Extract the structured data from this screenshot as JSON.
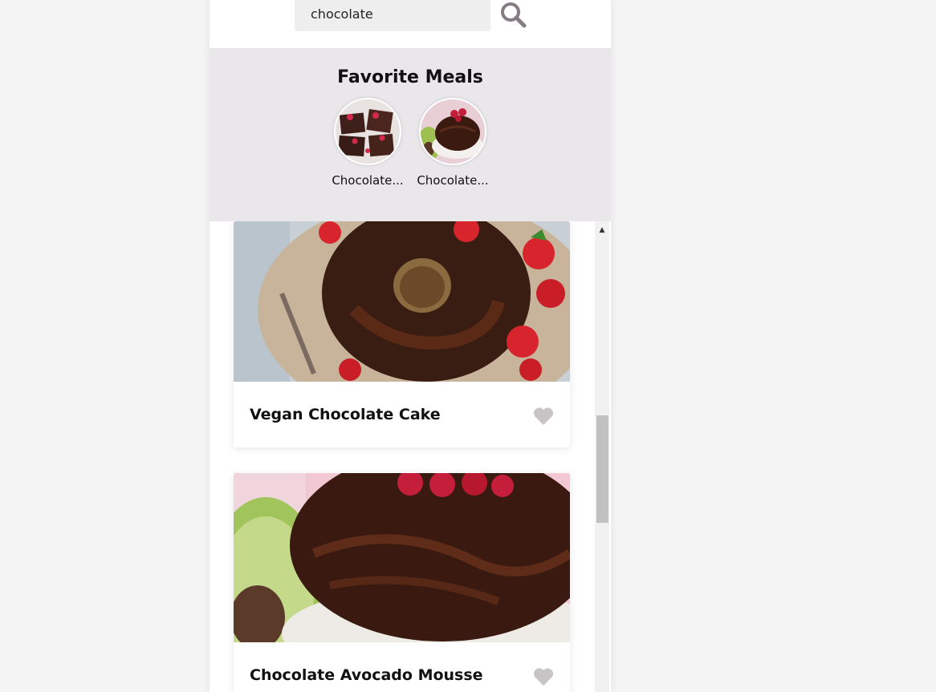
{
  "search": {
    "value": "chocolate",
    "button_icon": "search-icon"
  },
  "favorites": {
    "title": "Favorite Meals",
    "items": [
      {
        "name": "Chocolate..."
      },
      {
        "name": "Chocolate..."
      }
    ]
  },
  "meals": [
    {
      "title": "Vegan Chocolate Cake",
      "icon": "heart-icon"
    },
    {
      "title": "Chocolate Avocado Mousse",
      "icon": "heart-icon"
    }
  ],
  "colors": {
    "page_bg": "#f4f4f4",
    "fav_bg": "#e9e7ea",
    "heart": "#c8c3c4",
    "search_icon": "#857c84"
  }
}
